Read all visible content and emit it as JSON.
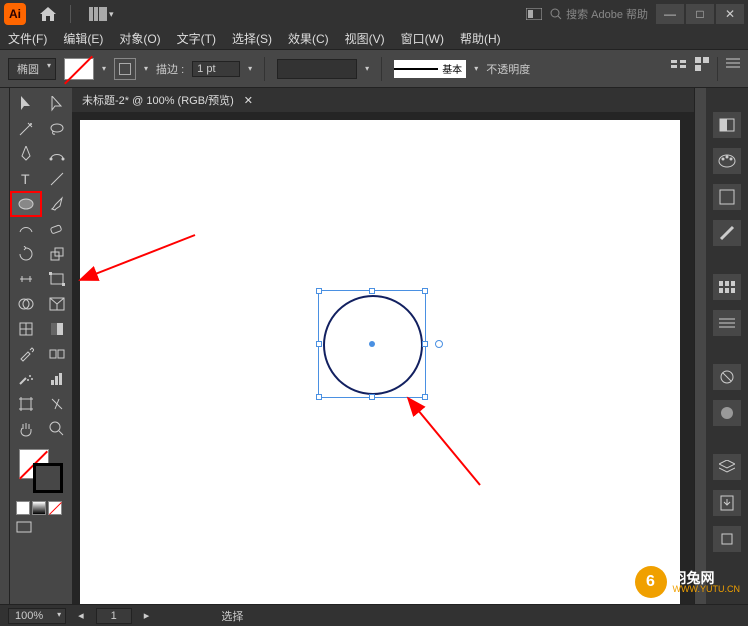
{
  "title": {
    "app": "Ai",
    "arrange_dropdown": "▾"
  },
  "search": {
    "placeholder": "搜索 Adobe 帮助"
  },
  "win": {
    "min": "—",
    "max": "□",
    "close": "✕"
  },
  "menu": [
    "文件(F)",
    "编辑(E)",
    "对象(O)",
    "文字(T)",
    "选择(S)",
    "效果(C)",
    "视图(V)",
    "窗口(W)",
    "帮助(H)"
  ],
  "control": {
    "shape_label": "椭圆",
    "stroke_label": "描边 :",
    "stroke_value": "1 pt",
    "style_label": "基本",
    "opacity_label": "不透明度"
  },
  "document": {
    "tab_title": "未标题-2* @ 100% (RGB/预览)",
    "tab_close": "✕"
  },
  "status": {
    "zoom": "100%",
    "info": "选择"
  },
  "watermark": {
    "icon": "6",
    "cn": "羽兔网",
    "en": "WWW.YUTU.CN"
  }
}
